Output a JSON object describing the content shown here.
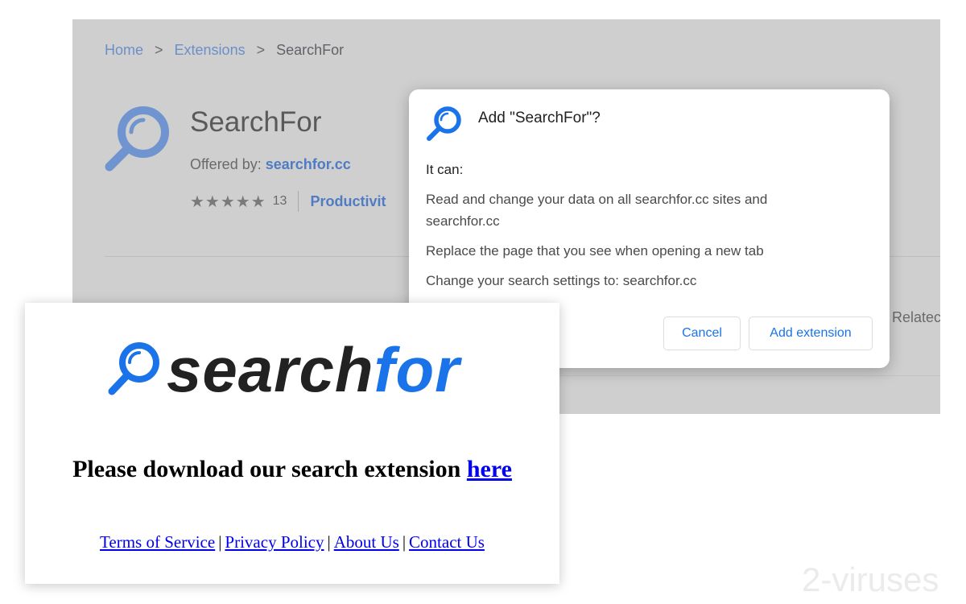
{
  "store": {
    "breadcrumb": [
      "Home",
      "Extensions",
      "SearchFor"
    ],
    "separator": ">",
    "title": "SearchFor",
    "offered_label": "Offered by:",
    "offered_by": "searchfor.cc",
    "stars": "★★★★★",
    "rating_count": "13",
    "category": "Productivit",
    "related": "Relatec",
    "icon": "magnifier-icon",
    "accent_color": "#4f7cc3"
  },
  "dialog": {
    "title": "Add \"SearchFor\"?",
    "it_can": "It can:",
    "permissions": [
      "Read and change your data on all searchfor.cc sites and searchfor.cc",
      "Replace the page that you see when opening a new tab",
      "Change your search settings to: searchfor.cc"
    ],
    "cancel_label": "Cancel",
    "add_label": "Add extension",
    "button_color": "#1a73e8"
  },
  "page": {
    "logo_search": "search",
    "logo_for": "for",
    "headline": "Please download our search extension",
    "headline_link": "here",
    "footer_links": [
      "Terms of Service",
      "Privacy Policy",
      "About Us",
      "Contact Us"
    ],
    "footer_separator": "|"
  },
  "watermark": "2-viruses"
}
